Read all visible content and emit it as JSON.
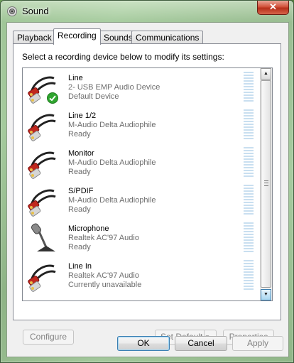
{
  "window": {
    "title": "Sound",
    "close_label": "✕"
  },
  "tabs": [
    {
      "label": "Playback"
    },
    {
      "label": "Recording"
    },
    {
      "label": "Sounds"
    },
    {
      "label": "Communications"
    }
  ],
  "instruction": "Select a recording device below to modify its settings:",
  "devices": [
    {
      "name": "Line",
      "description": "2- USB EMP Audio Device",
      "status": "Default Device",
      "icon": "rca-cable-icon",
      "default": true
    },
    {
      "name": "Line 1/2",
      "description": "M-Audio Delta Audiophile",
      "status": "Ready",
      "icon": "rca-cable-icon"
    },
    {
      "name": "Monitor",
      "description": "M-Audio Delta Audiophile",
      "status": "Ready",
      "icon": "rca-cable-icon"
    },
    {
      "name": "S/PDIF",
      "description": "M-Audio Delta Audiophile",
      "status": "Ready",
      "icon": "rca-cable-icon"
    },
    {
      "name": "Microphone",
      "description": "Realtek AC'97 Audio",
      "status": "Ready",
      "icon": "microphone-icon"
    },
    {
      "name": "Line In",
      "description": "Realtek AC'97 Audio",
      "status": "Currently unavailable",
      "icon": "rca-cable-icon"
    }
  ],
  "buttons": {
    "configure": "Configure",
    "set_default": "Set Default",
    "properties": "Properties",
    "ok": "OK",
    "cancel": "Cancel",
    "apply": "Apply"
  },
  "colors": {
    "selection_accent": "#3c7fb1",
    "cable_red": "#c0281e",
    "default_check": "#2fa52f"
  }
}
